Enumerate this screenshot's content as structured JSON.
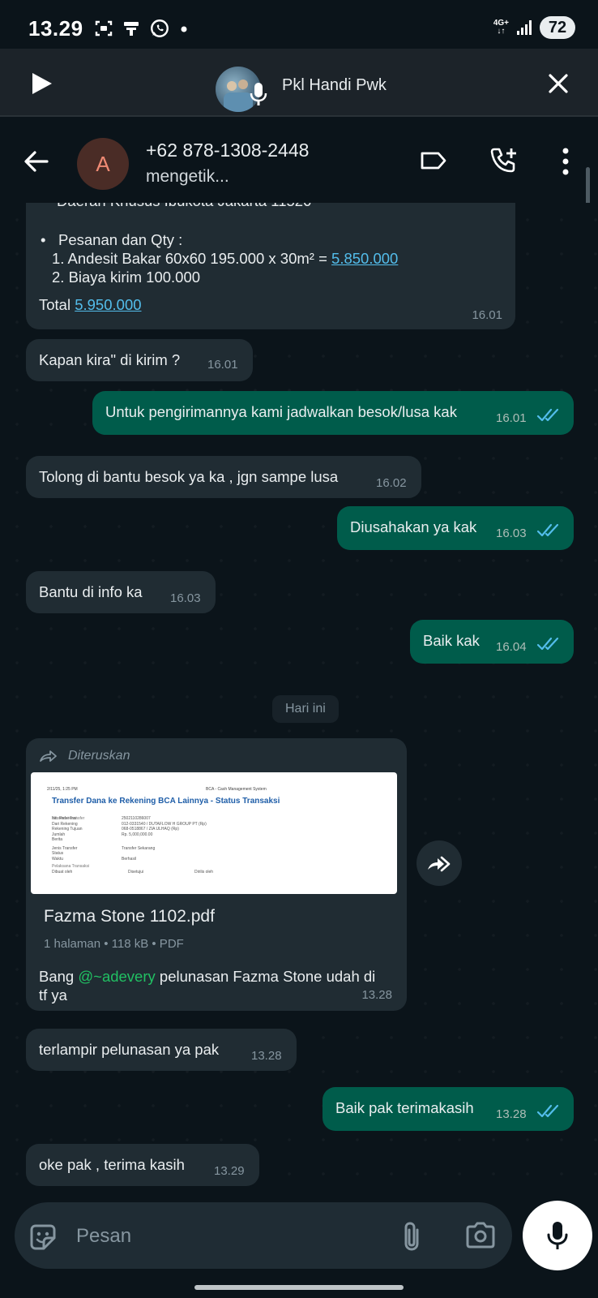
{
  "status_bar": {
    "time": "13.29",
    "network": "4G+",
    "battery": "72",
    "icons": [
      "screenshot-icon",
      "notification-icon",
      "whatsapp-icon",
      "dot-icon"
    ]
  },
  "call_bar": {
    "title": "Pkl Handi Pwk"
  },
  "chat_header": {
    "avatar_letter": "A",
    "contact": "+62 878-1308-2448",
    "status": "mengetik..."
  },
  "messages": [
    {
      "id": "order",
      "direction": "incoming",
      "partial_line": "Daerah Khusus Ibukota Jakarta 11520",
      "bullet_label": "Pesanan dan Qty :",
      "item1_text": "1. Andesit Bakar 60x60 195.000 x 30m² =",
      "item1_value": "5.850.000",
      "item2_text": "2. Biaya kirim 100.000",
      "total_label": "Total",
      "total_value": "5.950.000",
      "time": "16.01"
    },
    {
      "id": "m1",
      "direction": "incoming",
      "text": "Kapan kira\" di kirim ?",
      "time": "16.01"
    },
    {
      "id": "m2",
      "direction": "outgoing",
      "text": "Untuk pengirimannya kami jadwalkan besok/lusa kak",
      "time": "16.01",
      "read": true
    },
    {
      "id": "m3",
      "direction": "incoming",
      "text": "Tolong di bantu besok ya ka , jgn sampe lusa",
      "time": "16.02"
    },
    {
      "id": "m4",
      "direction": "outgoing",
      "text": "Diusahakan ya kak",
      "time": "16.03",
      "read": true
    },
    {
      "id": "m5",
      "direction": "incoming",
      "text": "Bantu di info ka",
      "time": "16.03"
    },
    {
      "id": "m6",
      "direction": "outgoing",
      "text": "Baik kak",
      "time": "16.04",
      "read": true
    },
    {
      "id": "doc",
      "direction": "incoming",
      "forwarded_label": "Diteruskan",
      "preview": {
        "header_left": "2/11/25, 1:25 PM",
        "header_right": "BCA - Cash Management System",
        "heading": "Transfer Dana ke Rekening BCA Lainnya - Status Transaksi",
        "section": "Informasi Transfer",
        "rows": [
          {
            "label": "No. Referensi",
            "value": "2502110286007"
          },
          {
            "label": "Dari Rekening",
            "value": "012-0331540 / DUTAFLOW H GROUP PT (Rp)"
          },
          {
            "label": "Rekening Tujuan",
            "value": "068-0518867 / ZIA ULHAQ (Rp)"
          },
          {
            "label": "Jumlah",
            "value": "Rp. 5,000,000.00"
          },
          {
            "label": "Berita",
            "value": ""
          },
          {
            "label": "Jenis Transfer",
            "value": "Transfer Sekarang"
          },
          {
            "label": "Status",
            "value": ""
          },
          {
            "label": "Waktu",
            "value": "Berhasil"
          }
        ],
        "section2": "Pelaksana Transaksi",
        "cols": [
          "Dibuat oleh",
          "Disetujui",
          "Dirilis oleh"
        ]
      },
      "file_name": "Fazma Stone 1102.pdf",
      "file_meta": "1 halaman • 118 kB • PDF",
      "caption_prefix": "Bang",
      "mention": "@~adevery",
      "caption_suffix": "pelunasan Fazma Stone udah di tf ya",
      "time": "13.28"
    },
    {
      "id": "m7",
      "direction": "incoming",
      "text": "terlampir pelunasan ya pak",
      "time": "13.28"
    },
    {
      "id": "m8",
      "direction": "outgoing",
      "text": "Baik pak terimakasih",
      "time": "13.28",
      "read": true
    },
    {
      "id": "m9",
      "direction": "incoming",
      "text": "oke pak , terima kasih",
      "time": "13.29"
    }
  ],
  "date_divider": "Hari ini",
  "composer": {
    "placeholder": "Pesan"
  },
  "colors": {
    "background": "#0b141a",
    "incoming": "#202c33",
    "outgoing": "#005c4b",
    "read_ticks": "#53bdeb",
    "mention": "#21c063"
  }
}
